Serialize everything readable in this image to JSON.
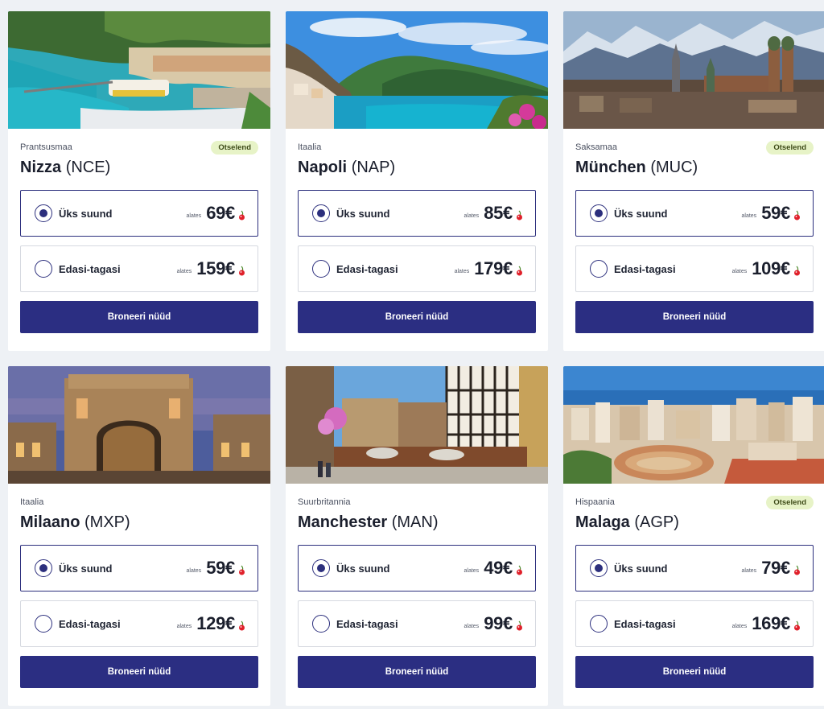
{
  "cards": [
    {
      "country": "Prantsusmaa",
      "badge": "Otselend",
      "city": "Nizza",
      "code": "(NCE)",
      "photo": "nice-coast-photo",
      "one_way_label": "Üks suund",
      "one_way_from": "alates",
      "one_way_price": "69€",
      "return_label": "Edasi-tagasi",
      "return_from": "alates",
      "return_price": "159€",
      "book_label": "Broneeri nüüd"
    },
    {
      "country": "Itaalia",
      "badge": "",
      "city": "Napoli",
      "code": "(NAP)",
      "photo": "naples-coast-photo",
      "one_way_label": "Üks suund",
      "one_way_from": "alates",
      "one_way_price": "85€",
      "return_label": "Edasi-tagasi",
      "return_from": "alates",
      "return_price": "179€",
      "book_label": "Broneeri nüüd"
    },
    {
      "country": "Saksamaa",
      "badge": "Otselend",
      "city": "München",
      "code": "(MUC)",
      "photo": "munich-skyline-photo",
      "one_way_label": "Üks suund",
      "one_way_from": "alates",
      "one_way_price": "59€",
      "return_label": "Edasi-tagasi",
      "return_from": "alates",
      "return_price": "109€",
      "book_label": "Broneeri nüüd"
    },
    {
      "country": "Itaalia",
      "badge": "",
      "city": "Milaano",
      "code": "(MXP)",
      "photo": "milan-galleria-photo",
      "one_way_label": "Üks suund",
      "one_way_from": "alates",
      "one_way_price": "59€",
      "return_label": "Edasi-tagasi",
      "return_from": "alates",
      "return_price": "129€",
      "book_label": "Broneeri nüüd"
    },
    {
      "country": "Suurbritannia",
      "badge": "",
      "city": "Manchester",
      "code": "(MAN)",
      "photo": "manchester-street-photo",
      "one_way_label": "Üks suund",
      "one_way_from": "alates",
      "one_way_price": "49€",
      "return_label": "Edasi-tagasi",
      "return_from": "alates",
      "return_price": "99€",
      "book_label": "Broneeri nüüd"
    },
    {
      "country": "Hispaania",
      "badge": "Otselend",
      "city": "Malaga",
      "code": "(AGP)",
      "photo": "malaga-bullring-photo",
      "one_way_label": "Üks suund",
      "one_way_from": "alates",
      "one_way_price": "79€",
      "return_label": "Edasi-tagasi",
      "return_from": "alates",
      "return_price": "169€",
      "book_label": "Broneeri nüüd"
    }
  ],
  "colors": {
    "brand": "#2b2e82",
    "badge_bg": "#e7f3c7",
    "cherry": "#e0202a"
  }
}
